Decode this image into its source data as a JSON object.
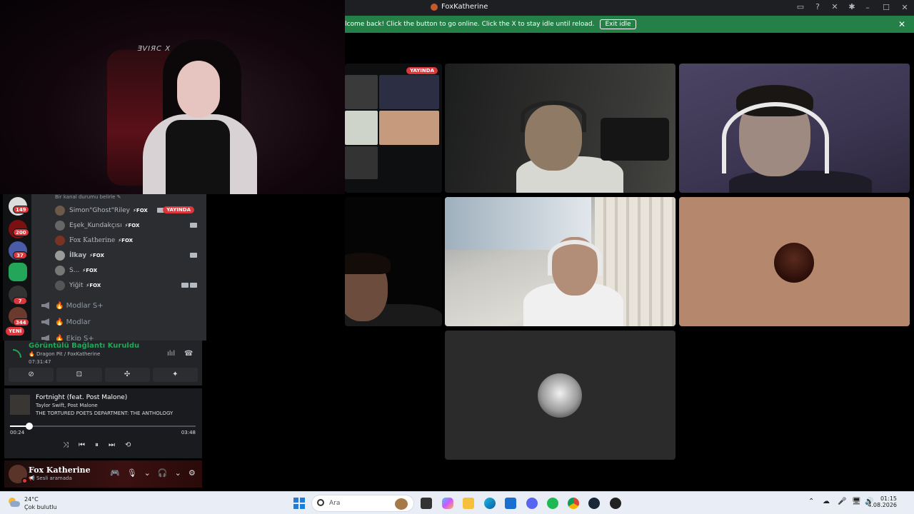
{
  "window": {
    "title": "FoxKatherine",
    "controls": [
      "minimize",
      "maximize",
      "close"
    ],
    "toolbar_icons": [
      "inbox-icon",
      "help-icon",
      "tools-icon",
      "bug-icon"
    ]
  },
  "notice": {
    "message": "lcome back! Click the button to go online. Click the X to stay idle until reload.",
    "button": "Exit idle",
    "close": "✕"
  },
  "webcam": {
    "logo_text": "ƎVIЯC X"
  },
  "guilds": {
    "badges": [
      "149",
      "200",
      "37",
      "7",
      "344"
    ],
    "new_label": "YENİ"
  },
  "channel_list": {
    "status_hint": "Bir kanal durumu belirle ✎",
    "voice_users": [
      {
        "name": "Simon\"Ghost\"Riley",
        "tag": "⚡FOX",
        "live": "YAYINDA"
      },
      {
        "name": "Eşek_Kundakçısı",
        "tag": "⚡FOX"
      },
      {
        "name": "Fox Katherine",
        "tag": "⚡FOX"
      },
      {
        "name": "İlkay",
        "tag": "⚡FOX"
      },
      {
        "name": "S...",
        "tag": "⚡FOX"
      },
      {
        "name": "Yiğit",
        "tag": "⚡FOX"
      }
    ],
    "voice_channels": [
      "🔥 Modlar S+",
      "🔥 Modlar",
      "🔥 Ekip S+"
    ]
  },
  "voice_panel": {
    "title": "Görüntülü Bağlantı Kuruldu",
    "subtitle": "🔥 Dragon Pit / FoxKatherine",
    "elapsed": "07:31:47",
    "buttons": [
      "⊘",
      "⊡",
      "✣",
      "✦"
    ]
  },
  "music": {
    "song": "Fortnight (feat. Post Malone)",
    "artist": "Taylor Swift, Post Malone",
    "album": "THE TORTURED POETS DEPARTMENT: THE ANTHOLOGY",
    "current_time": "00:24",
    "total_time": "03:48",
    "progress": 0.105,
    "controls": [
      "⤨",
      "⏮",
      "⏸",
      "⏭",
      "⟲"
    ]
  },
  "user_panel": {
    "name": "Fox Katherine",
    "status": "📢 Sesli aramada",
    "icons": [
      "🎮",
      "🎙",
      "⌄",
      "🎧",
      "⌄",
      "⚙"
    ]
  },
  "stream_tile": {
    "live_label": "YAYINDA"
  },
  "taskbar": {
    "temperature": "24°C",
    "weather": "Çok bulutlu",
    "search_placeholder": "Ara",
    "time": "01:15",
    "date": "4.08.2026",
    "tray_icons": [
      "⌃",
      "☁",
      "🎤",
      "🖥",
      "🔊"
    ]
  },
  "colors": {
    "accent_green": "#248046",
    "live_red": "#da373c",
    "voice_green": "#23a55a"
  }
}
